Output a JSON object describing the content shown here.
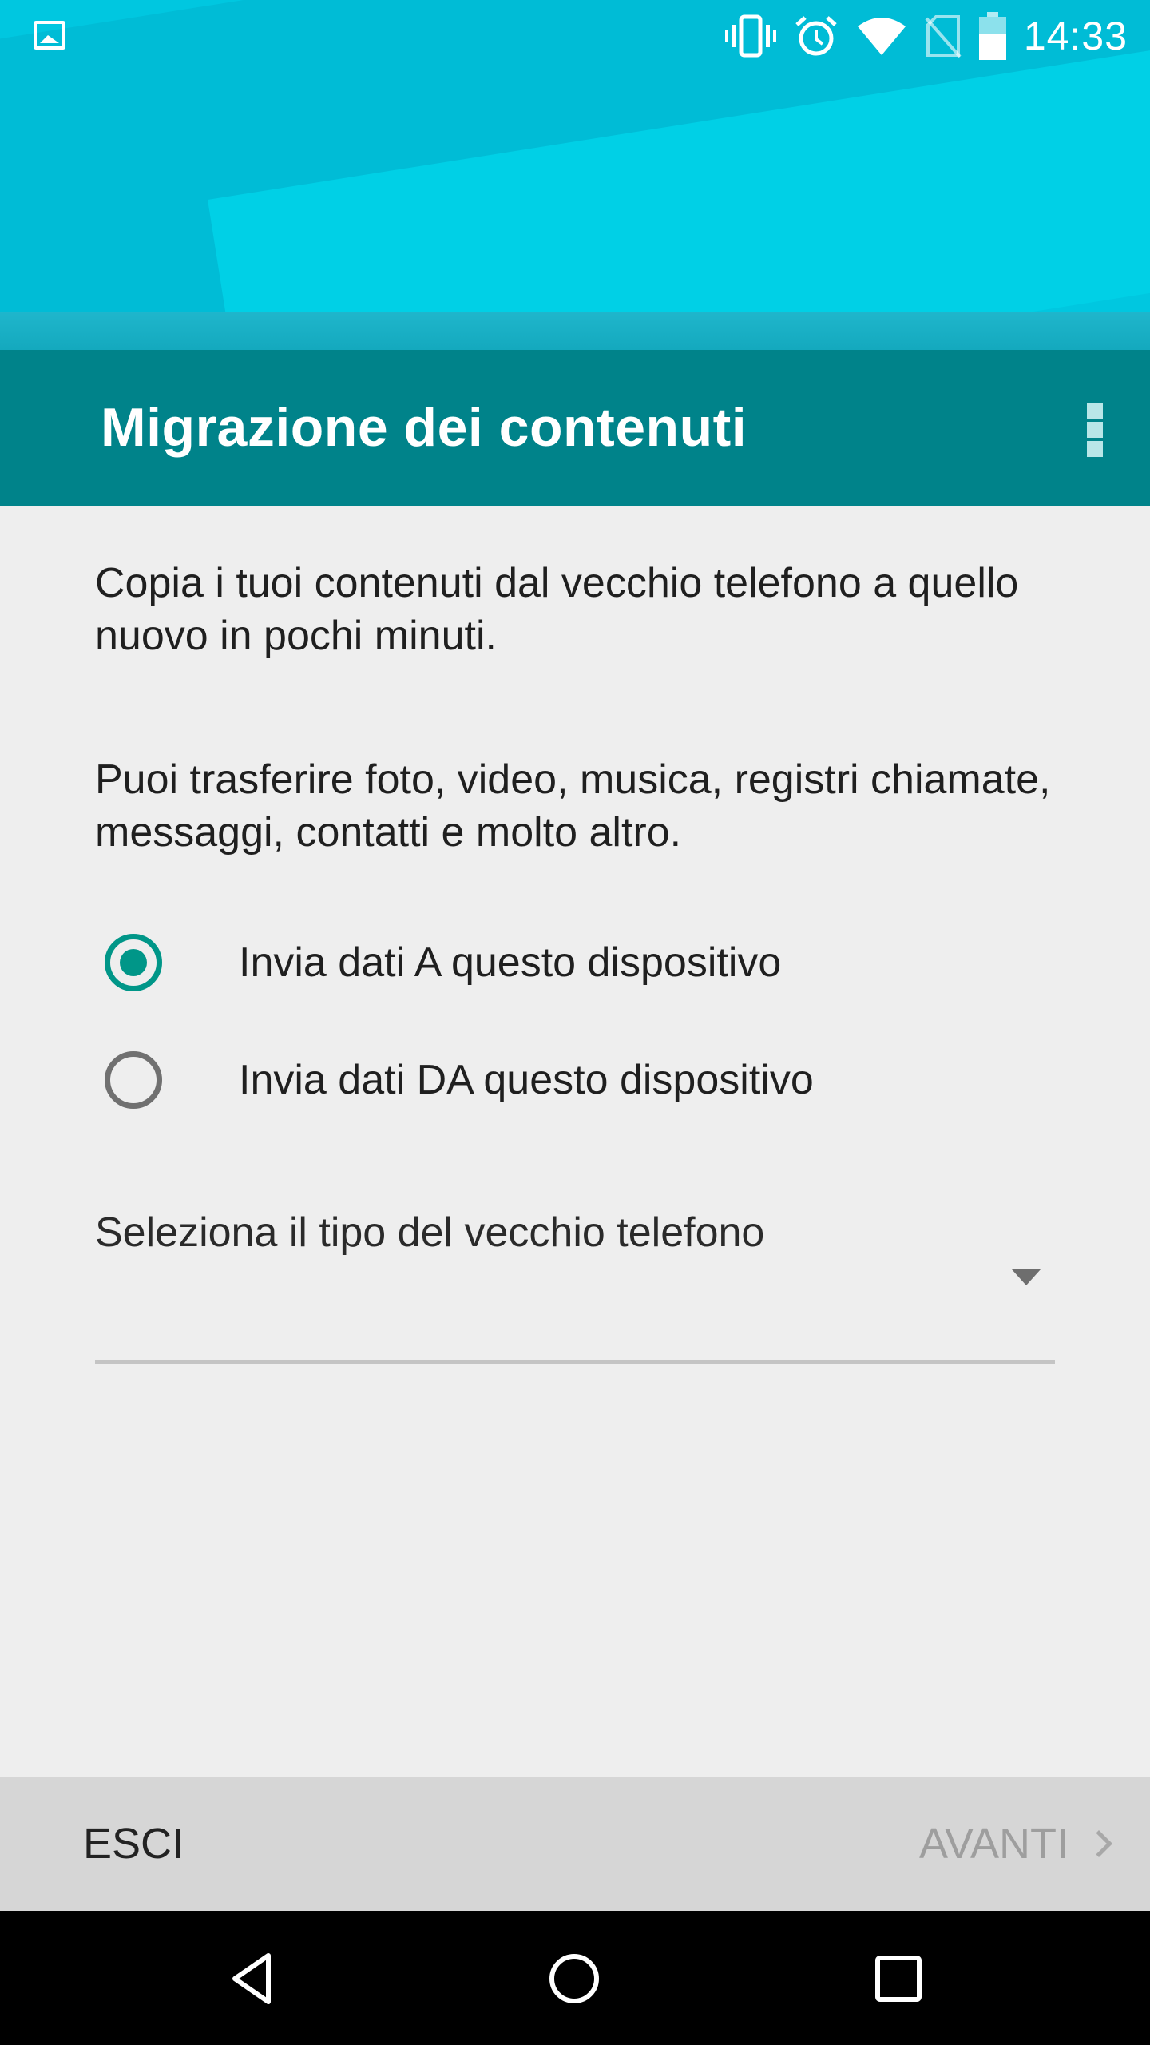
{
  "status_bar": {
    "time": "14:33",
    "icons": [
      "image-notification-icon",
      "vibrate-icon",
      "alarm-icon",
      "wifi-icon",
      "no-sim-icon",
      "battery-icon"
    ]
  },
  "app_bar": {
    "title": "Migrazione dei contenuti",
    "menu_icon": "overflow-menu-icon"
  },
  "content": {
    "paragraph_1": "Copia i tuoi contenuti dal vecchio telefono a quello nuovo in pochi minuti.",
    "paragraph_2": "Puoi trasferire foto, video, musica, registri chiamate, messaggi, contatti e molto altro.",
    "options": [
      {
        "label": "Invia dati A questo dispositivo",
        "selected": true
      },
      {
        "label": "Invia dati DA questo dispositivo",
        "selected": false
      }
    ],
    "dropdown": {
      "label": "Seleziona il tipo del vecchio telefono"
    }
  },
  "bottom_bar": {
    "exit_label": "ESCI",
    "next_label": "AVANTI",
    "next_enabled": false
  },
  "nav_bar": {
    "buttons": [
      "back-icon",
      "home-icon",
      "recents-icon"
    ]
  },
  "colors": {
    "header": "#00c7e0",
    "app_bar": "#00838a",
    "accent": "#009688",
    "background": "#eeeeee",
    "bottom_bar": "#d6d6d6"
  }
}
